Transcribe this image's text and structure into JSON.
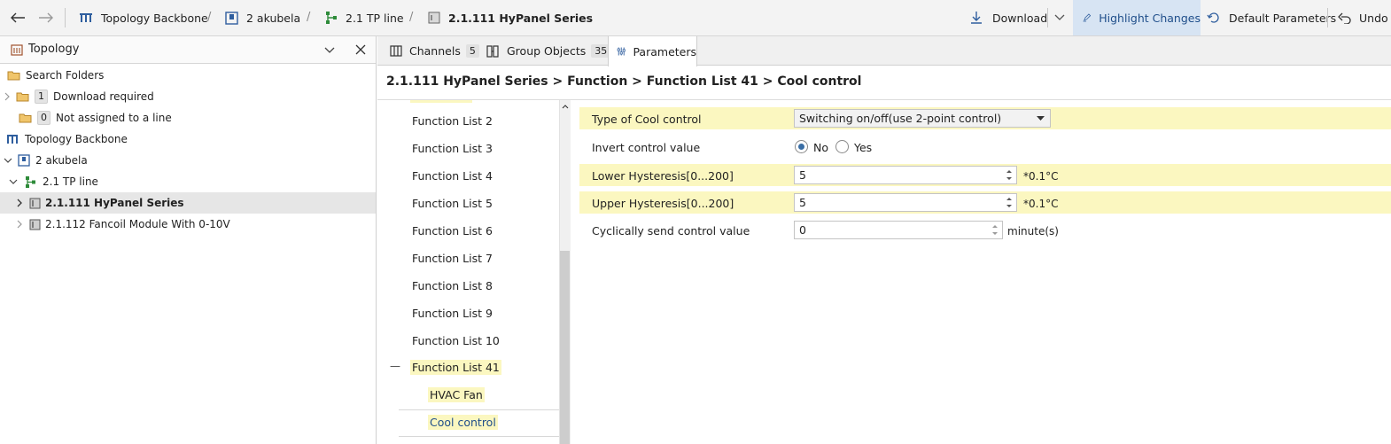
{
  "toolbar": {
    "breadcrumbs": [
      "Topology Backbone",
      "2 akubela",
      "2.1 TP line",
      "2.1.111 HyPanel Series"
    ],
    "download_label": "Download",
    "highlight_label": "Highlight Changes",
    "default_params_label": "Default Parameters",
    "undo_label": "Undo"
  },
  "topology_panel": {
    "title": "Topology",
    "items": [
      {
        "label": "Search Folders"
      },
      {
        "label": "Download required",
        "count": "1"
      },
      {
        "label": "Not assigned to a line",
        "count": "0"
      },
      {
        "label": "Topology Backbone"
      },
      {
        "label": "2 akubela"
      },
      {
        "label": "2.1 TP line"
      },
      {
        "label": "2.1.111 HyPanel Series"
      },
      {
        "label": "2.1.112 Fancoil Module With 0-10V"
      }
    ]
  },
  "tabs": [
    {
      "label": "Channels",
      "count": "5"
    },
    {
      "label": "Group Objects",
      "count": "35"
    },
    {
      "label": "Parameters"
    }
  ],
  "breadcrumb_title": "2.1.111 HyPanel Series > Function > Function List 41 > Cool control",
  "function_tree": [
    "Function List 2",
    "Function List 3",
    "Function List 4",
    "Function List 5",
    "Function List 6",
    "Function List 7",
    "Function List 8",
    "Function List 9",
    "Function List 10",
    "Function List 41",
    "HVAC Fan",
    "Cool control"
  ],
  "collapse_glyph": "—",
  "parameters": {
    "type": {
      "label": "Type of Cool control",
      "value": "Switching on/off(use 2-point control)"
    },
    "invert": {
      "label": "Invert control value",
      "option_no": "No",
      "option_yes": "Yes",
      "selected": "No"
    },
    "lower": {
      "label": "Lower Hysteresis[0...200]",
      "value": "5",
      "unit": "*0.1°C"
    },
    "upper": {
      "label": "Upper Hysteresis[0...200]",
      "value": "5",
      "unit": "*0.1°C"
    },
    "cyclic": {
      "label": "Cyclically send control value",
      "value": "0",
      "unit": "minute(s)"
    }
  },
  "colors": {
    "accent": "#2f5e9e",
    "highlight": "#fbf7c0",
    "selected_row": "#e6e6e6",
    "green_icon": "#2e8b3a"
  }
}
